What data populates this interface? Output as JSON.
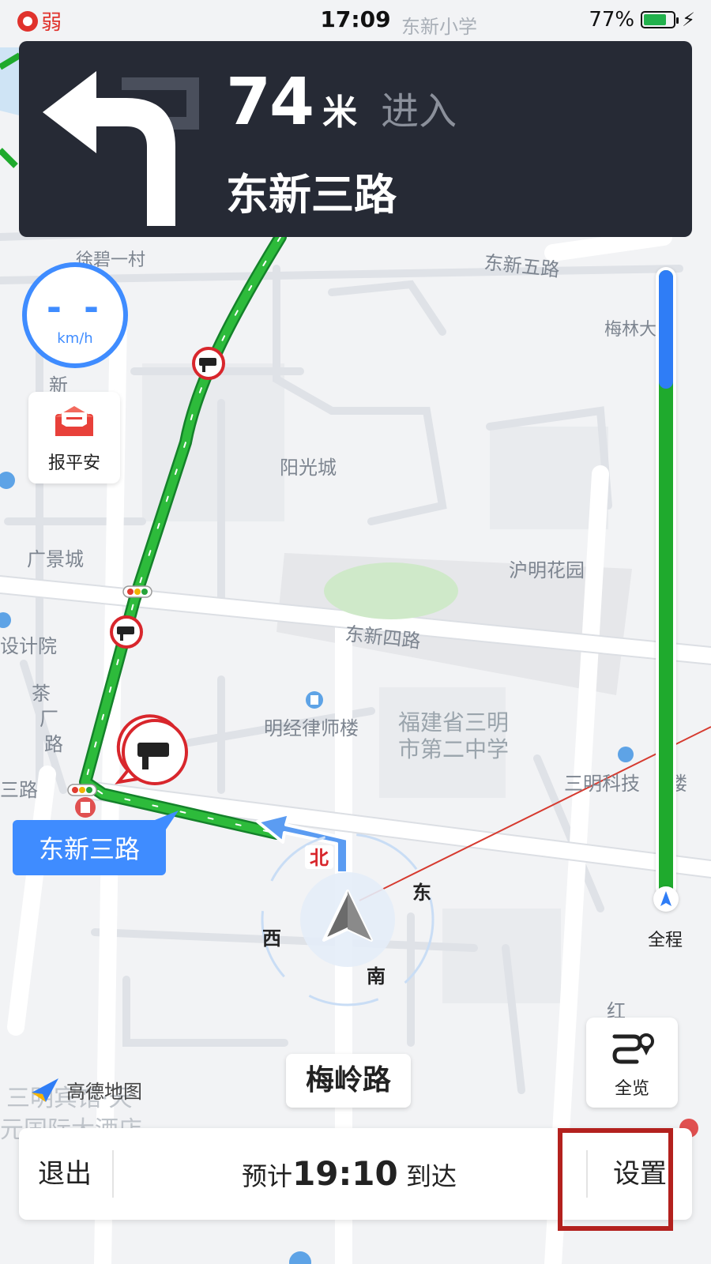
{
  "status_bar": {
    "network": "弱",
    "time": "17:09",
    "battery": "77%"
  },
  "guidance": {
    "distance": "74",
    "unit": "米",
    "action": "进入",
    "road": "东新三路",
    "turn_icon": "turn-left-arrow-icon"
  },
  "speed": {
    "value": "- -",
    "unit": "km/h"
  },
  "safe_report": {
    "label": "报平安",
    "icon": "envelope-icon"
  },
  "map_labels": [
    "东新小学",
    "徐碧一村",
    "东新五路",
    "梅林大",
    "阳光城",
    "广景城",
    "沪明花园",
    "东新四路",
    "设计院",
    "明经律师楼",
    "福建省三明",
    "市第二中学",
    "茶",
    "厂",
    "路",
    "三路",
    "三明科技",
    "楼",
    "东新三路",
    "梅岭路",
    "红",
    "三明宾馆·天",
    "元国际大酒店",
    "新",
    "东",
    "西",
    "南",
    "北"
  ],
  "compass": {
    "north": "北",
    "east": "东",
    "west": "西",
    "south": "南"
  },
  "route_badge": "东新三路",
  "route_progress": {
    "traveled_fraction": 0.19,
    "label": "全程"
  },
  "overview_button": {
    "label": "全览",
    "icon": "route-overview-icon"
  },
  "current_road": "梅岭路",
  "map_logo": "高德地图",
  "bottom_bar": {
    "exit_label": "退出",
    "eta_prefix": "预计",
    "eta_time": "19:10",
    "eta_suffix": "到达",
    "settings_label": "设置"
  },
  "colors": {
    "route": "#1faa2d",
    "panel": "#262a35",
    "accent_blue": "#3f8cff",
    "highlight": "#b3211e"
  }
}
